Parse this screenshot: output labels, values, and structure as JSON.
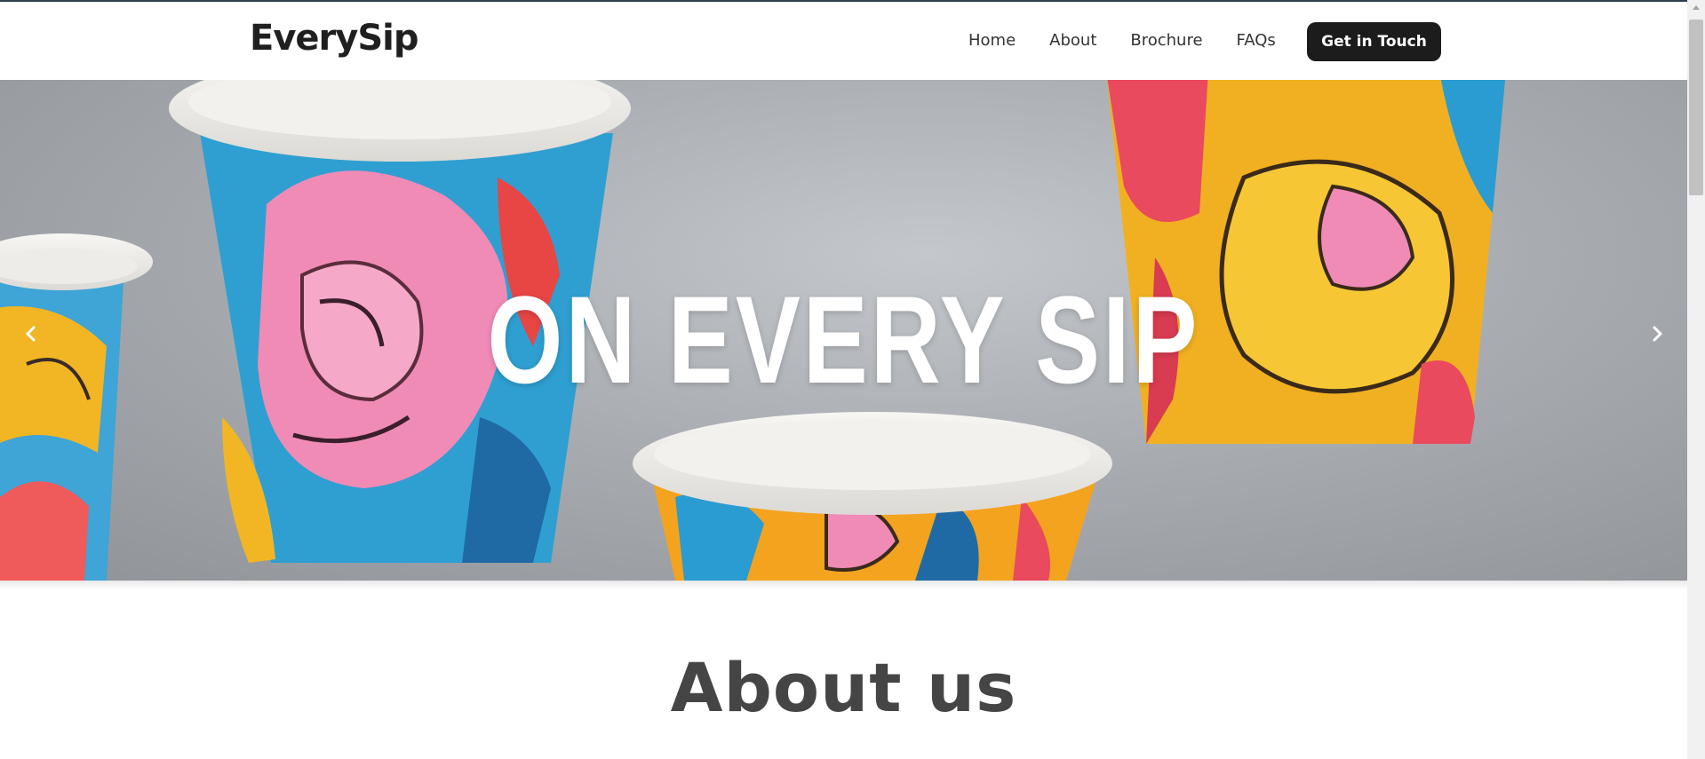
{
  "header": {
    "logo": "EverySip",
    "nav": [
      "Home",
      "About",
      "Brochure",
      "FAQs"
    ],
    "cta_label": "Get in Touch"
  },
  "hero": {
    "title": "ON EVERY SIP",
    "prev_icon": "chevron-left-icon",
    "next_icon": "chevron-right-icon"
  },
  "about": {
    "heading": "About us"
  },
  "colors": {
    "nav_text": "#333333",
    "cta_bg": "#1c1c1c",
    "hero_bg": "#a9adb2",
    "heading": "#454545"
  }
}
